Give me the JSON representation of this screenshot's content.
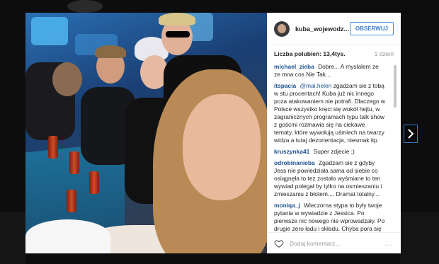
{
  "post": {
    "username": "kuba_wojewodz...",
    "follow_label": "OBSERWUJ",
    "likes": "Liczba polubień: 13,4tys.",
    "time_ago": "1 dzień",
    "comment_placeholder": "Dodaj komentarz...",
    "more_label": "..."
  },
  "comments": [
    {
      "user": "michael_zieba",
      "mention": "",
      "text": "Dobre... A myslalem ze ze mna cos Nie Tak..."
    },
    {
      "user": "itspacia",
      "mention": "@mai.helen",
      "text": "zgadzam sie z tobą w stu procentach! Kuba już nic innego poza atakowaniem nie potrafi. Dlaczego w Polsce wszystko kręci się wokół hejtu, w zagranicznych programach typu talk show z gośćmi rozmawia się na ciekawe tematy, które wywołują uśmiech na twarzy widza a tutaj dezorientacja, niesmak itp."
    },
    {
      "user": "kruszynka41",
      "mention": "",
      "text": "Super zdjecie ;)"
    },
    {
      "user": "odrobinanieba",
      "mention": "",
      "text": "Zgadzam sie z gdyby Jess nie powiedziała sama od siebie co osiągnęła to tez zostało wyśmiane to ten wywiad polegał by tylko na osmieszaniu i zmieszaniu z błotem.... Dramat totalny..."
    },
    {
      "user": "moniqa_j",
      "mention": "",
      "text": "Wieczorna stypa to były twoje pytania w wywiadzie z Jessica. Po pierwsze nic nowego nie wprowadzały. Po drugie zero ładu i składu. Chyba pora się zawijać z tvn..."
    }
  ],
  "icons": {
    "heart": "heart-outline-icon",
    "next": "chevron-right-icon"
  },
  "colors": {
    "accent": "#3b7fd0",
    "username_link": "#1c4f8c"
  }
}
